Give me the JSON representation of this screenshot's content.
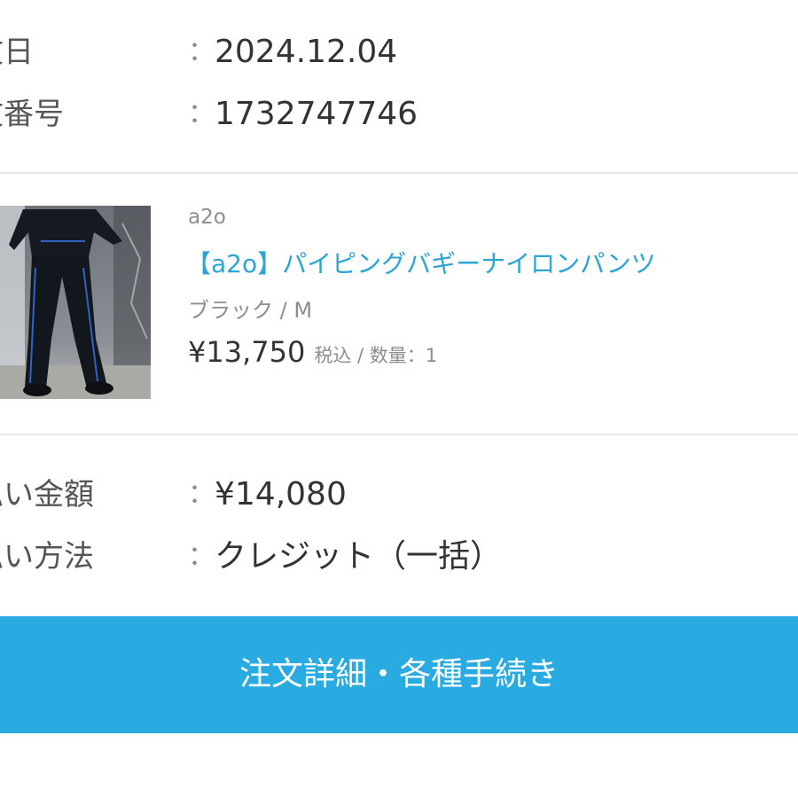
{
  "order_info": {
    "rows": [
      {
        "label": "文日",
        "value": "2024.12.04"
      },
      {
        "label": "文番号",
        "value": "1732747746"
      }
    ]
  },
  "separator": "：",
  "product": {
    "image_icon": "product-photo",
    "brand": "a2o",
    "title": "【a2o】パイピングバギーナイロンパンツ",
    "variant": "ブラック / M",
    "price": "¥13,750",
    "tax_quantity": "税込 / 数量：1"
  },
  "payment_info": {
    "rows": [
      {
        "label": "払い金額",
        "value": "¥14,080"
      },
      {
        "label": "払い方法",
        "value": "クレジット（一括）"
      }
    ]
  },
  "action_button": {
    "label": "注文詳細・各種手続き"
  },
  "colors": {
    "accent": "#29aae1",
    "link": "#29a5d6",
    "text": "#333333",
    "muted": "#8d8d8d"
  }
}
